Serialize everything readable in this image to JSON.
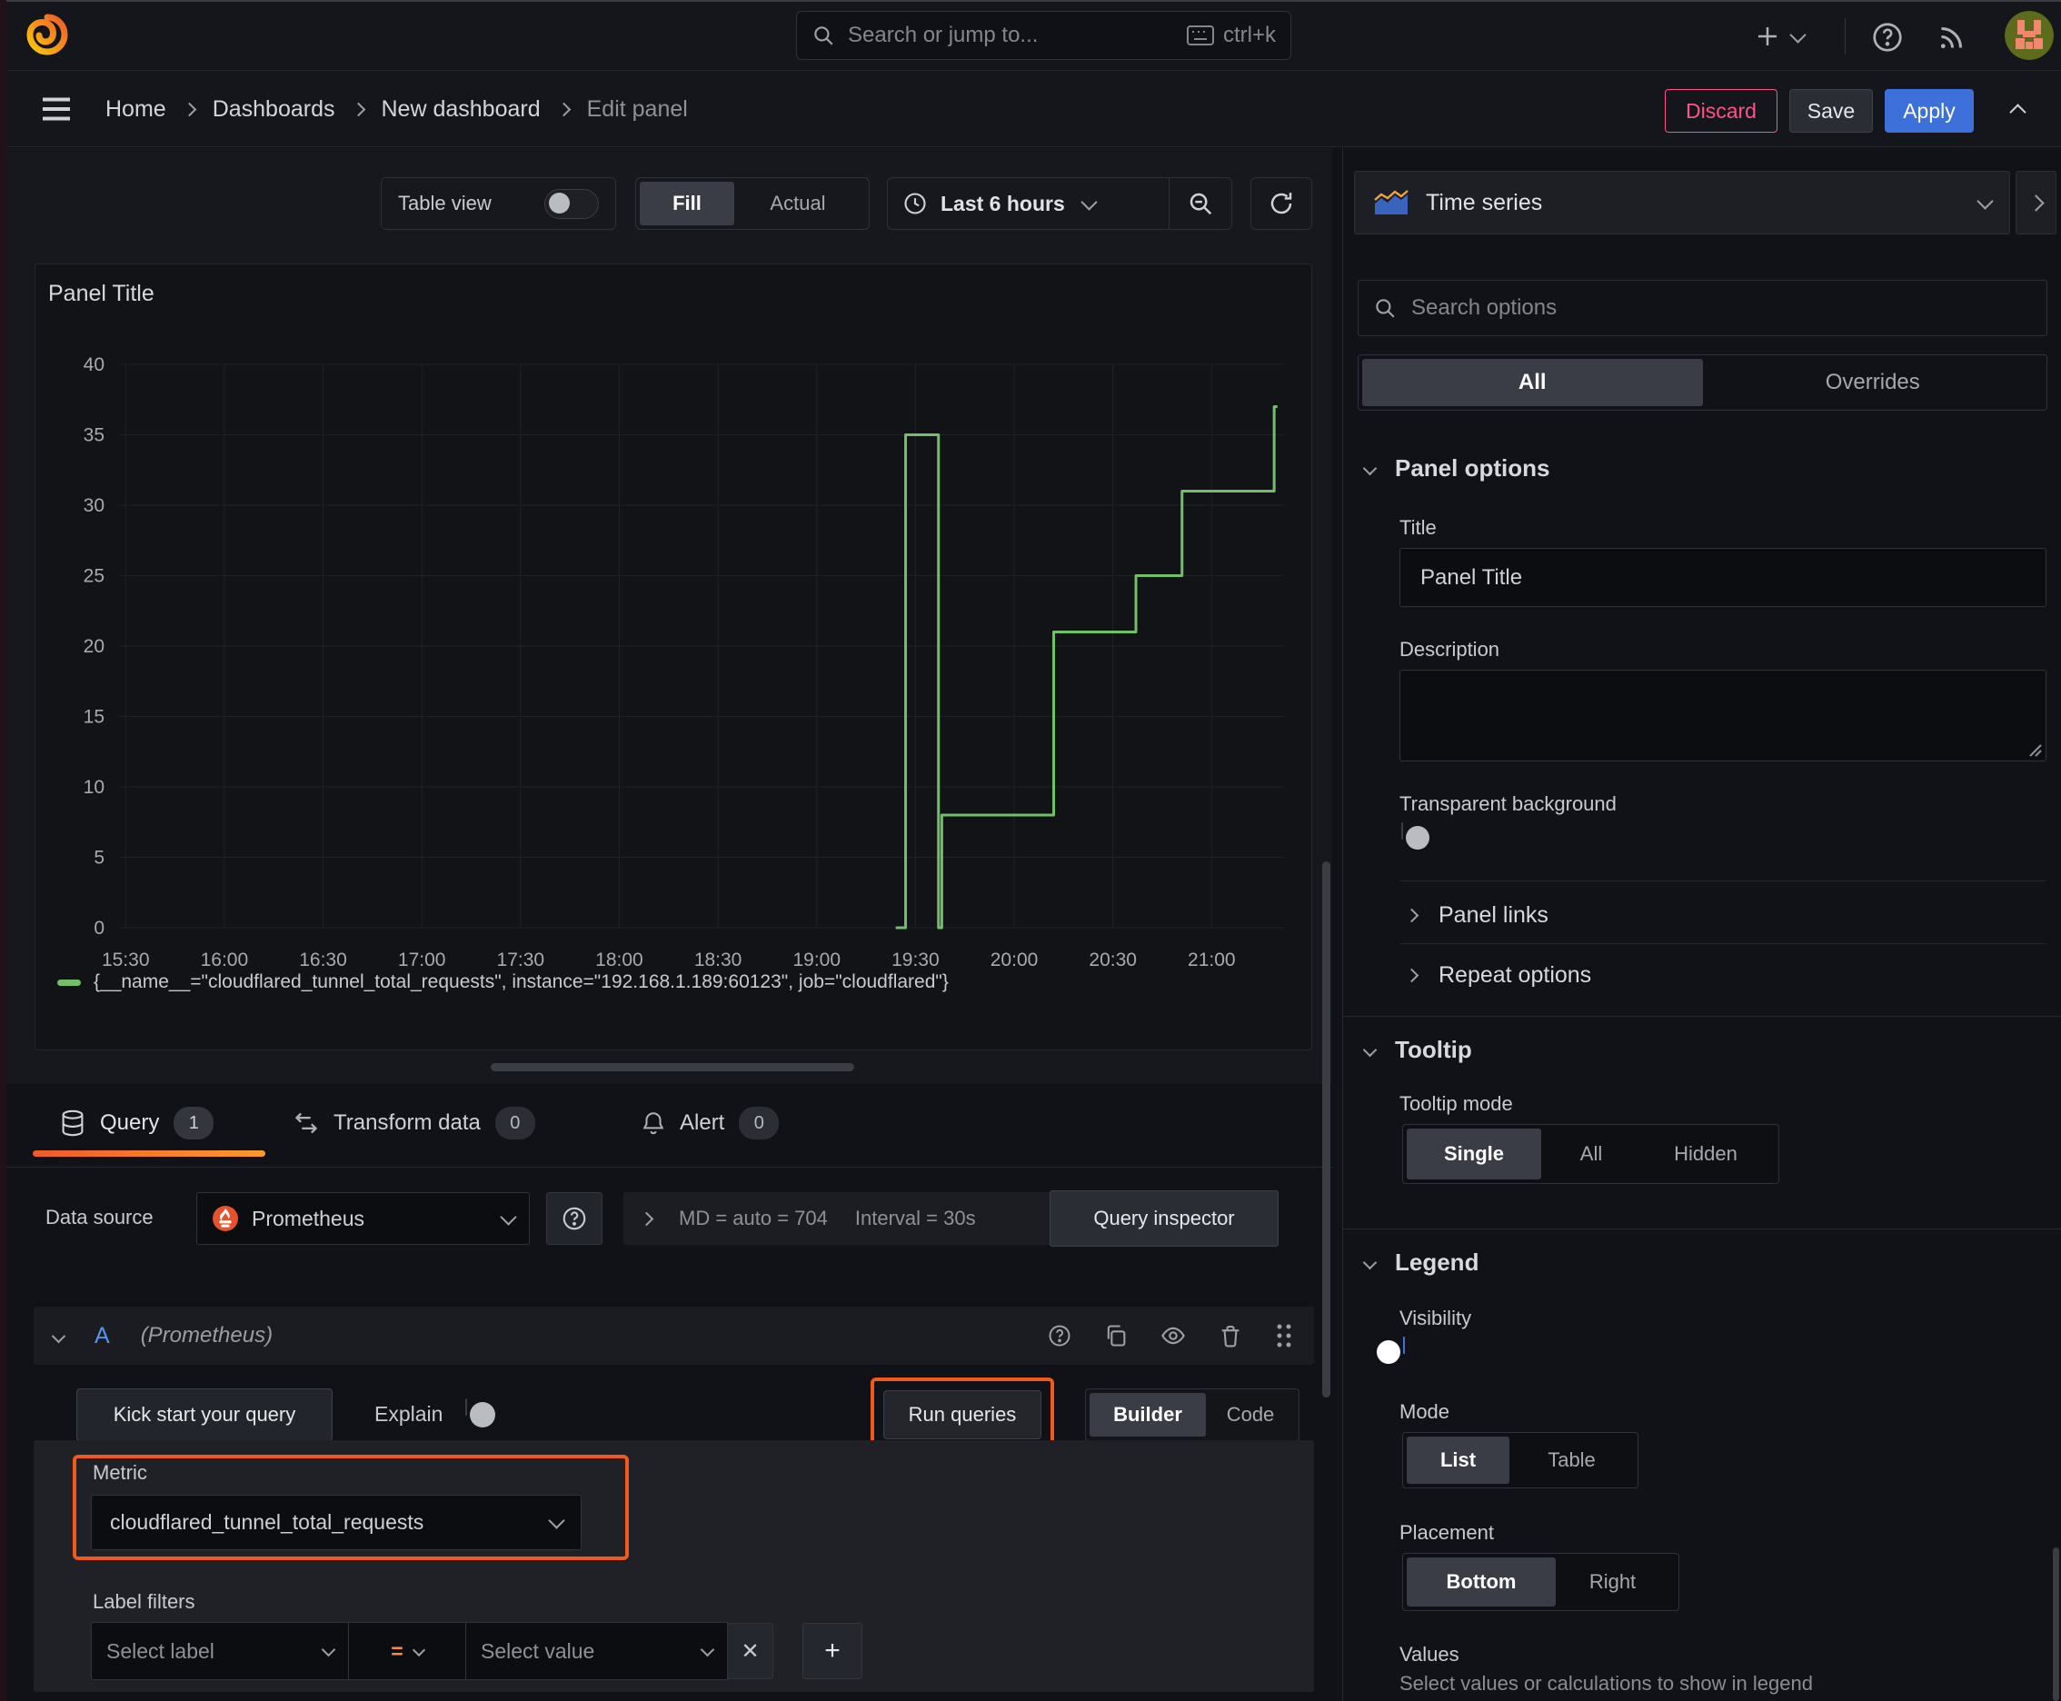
{
  "topbar": {
    "search_placeholder": "Search or jump to...",
    "shortcut": "ctrl+k"
  },
  "breadcrumb": {
    "items": [
      "Home",
      "Dashboards",
      "New dashboard"
    ],
    "current": "Edit panel",
    "discard_label": "Discard",
    "save_label": "Save",
    "apply_label": "Apply"
  },
  "toolbar": {
    "table_view_label": "Table view",
    "fill_label": "Fill",
    "actual_label": "Actual",
    "time_range_label": "Last 6 hours"
  },
  "panel": {
    "title": "Panel Title"
  },
  "chart_data": {
    "type": "line",
    "step": true,
    "title": "Panel Title",
    "x_domain": [
      "15:28",
      "21:22"
    ],
    "x_ticks": [
      "15:30",
      "16:00",
      "16:30",
      "17:00",
      "17:30",
      "18:00",
      "18:30",
      "19:00",
      "19:30",
      "20:00",
      "20:30",
      "21:00"
    ],
    "y_ticks": [
      0,
      5,
      10,
      15,
      20,
      25,
      30,
      35,
      40
    ],
    "ylim": [
      0,
      40
    ],
    "grid": true,
    "legend_position": "bottom",
    "series": [
      {
        "name": "{__name__=\"cloudflared_tunnel_total_requests\", instance=\"192.168.1.189:60123\", job=\"cloudflared\"}",
        "color": "#73BF69",
        "points": [
          [
            "19:24",
            0
          ],
          [
            "19:27",
            35
          ],
          [
            "19:37",
            0
          ],
          [
            "19:38",
            8
          ],
          [
            "20:12",
            21
          ],
          [
            "20:37",
            25
          ],
          [
            "20:51",
            31
          ],
          [
            "21:19",
            37
          ],
          [
            "21:20",
            37
          ]
        ]
      }
    ]
  },
  "tabs": {
    "query_label": "Query",
    "query_count": "1",
    "transform_label": "Transform data",
    "transform_count": "0",
    "alert_label": "Alert",
    "alert_count": "0"
  },
  "datasource": {
    "label": "Data source",
    "name": "Prometheus",
    "max_data_points": "MD = auto = 704",
    "interval": "Interval = 30s",
    "inspector_label": "Query inspector"
  },
  "query": {
    "ref_id": "A",
    "ds_hint": "(Prometheus)",
    "kickstart_label": "Kick start your query",
    "explain_label": "Explain",
    "run_label": "Run queries",
    "builder_label": "Builder",
    "code_label": "Code",
    "metric_label": "Metric",
    "metric_value": "cloudflared_tunnel_total_requests",
    "label_filters_label": "Label filters",
    "select_label_placeholder": "Select label",
    "operator": "=",
    "select_value_placeholder": "Select value"
  },
  "options": {
    "visualization": "Time series",
    "search_placeholder": "Search options",
    "tab_all": "All",
    "tab_overrides": "Overrides",
    "panel_options": {
      "title": "Panel options",
      "title_label": "Title",
      "title_value": "Panel Title",
      "description_label": "Description",
      "transparent_label": "Transparent background",
      "panel_links_label": "Panel links",
      "repeat_options_label": "Repeat options"
    },
    "tooltip": {
      "title": "Tooltip",
      "mode_label": "Tooltip mode",
      "mode_single": "Single",
      "mode_all": "All",
      "mode_hidden": "Hidden",
      "selected": "Single"
    },
    "legend": {
      "title": "Legend",
      "visibility_label": "Visibility",
      "mode_label": "Mode",
      "mode_list": "List",
      "mode_table": "Table",
      "selected_mode": "List",
      "placement_label": "Placement",
      "placement_bottom": "Bottom",
      "placement_right": "Right",
      "selected_placement": "Bottom",
      "values_label": "Values",
      "values_hint": "Select values or calculations to show in legend"
    }
  },
  "colors": {
    "series_green": "#73BF69",
    "accent_orange": "#f25a1c",
    "primary_blue": "#3d71d9",
    "destructive_pink": "#ff5286",
    "ref_id_blue": "#5794f2"
  }
}
